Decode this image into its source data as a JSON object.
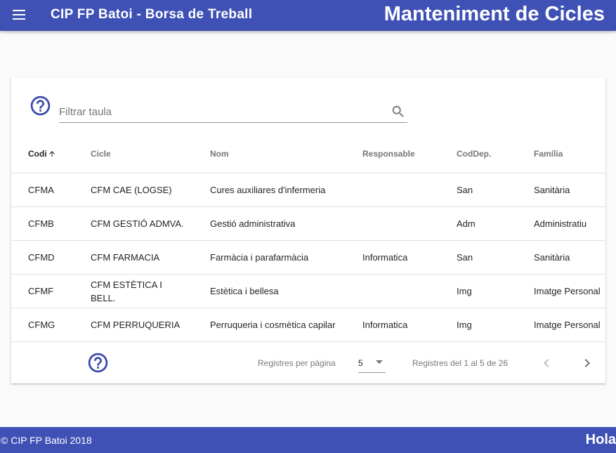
{
  "header": {
    "app_title": "CIP FP Batoi - Borsa de Treball",
    "page_title": "Manteniment de Cicles"
  },
  "filter": {
    "placeholder": "Filtrar taula",
    "value": ""
  },
  "table": {
    "columns": [
      "Codi",
      "Cicle",
      "Nom",
      "Responsable",
      "CodDep.",
      "Família"
    ],
    "sorted_column": "Codi",
    "sort_direction": "ascending",
    "rows": [
      [
        "CFMA",
        "CFM CAE (LOGSE)",
        "Cures auxiliares d'infermeria",
        "",
        "San",
        "Sanitària"
      ],
      [
        "CFMB",
        "CFM GESTIÓ ADMVA.",
        "Gestió administrativa",
        "",
        "Adm",
        "Administratiu"
      ],
      [
        "CFMD",
        "CFM FARMACIA",
        "Farmàcia i parafarmàcia",
        "Informatica",
        "San",
        "Sanitària"
      ],
      [
        "CFMF",
        "CFM ESTÈTICA I BELL.",
        "Estètica i bellesa",
        "",
        "Img",
        "Imatge Personal"
      ],
      [
        "CFMG",
        "CFM PERRUQUERIA",
        "Perruqueria i cosmètica capilar",
        "Informatica",
        "Img",
        "Imatge Personal"
      ]
    ]
  },
  "paginator": {
    "page_size_label": "Registres per pàgina",
    "page_size": "5",
    "range_label": "Registres del 1 al 5 de 26"
  },
  "footer": {
    "copyright": "© CIP FP Batoi 2018",
    "greeting": "Hola"
  },
  "icons": {
    "menu": "menu-icon",
    "help": "help-circle-icon",
    "search": "search-icon",
    "sort": "arrow-up-icon",
    "prev": "chevron-left-icon",
    "next": "chevron-right-icon"
  },
  "colors": {
    "primary": "#3f51b5",
    "help_icon": "#3949ab"
  }
}
